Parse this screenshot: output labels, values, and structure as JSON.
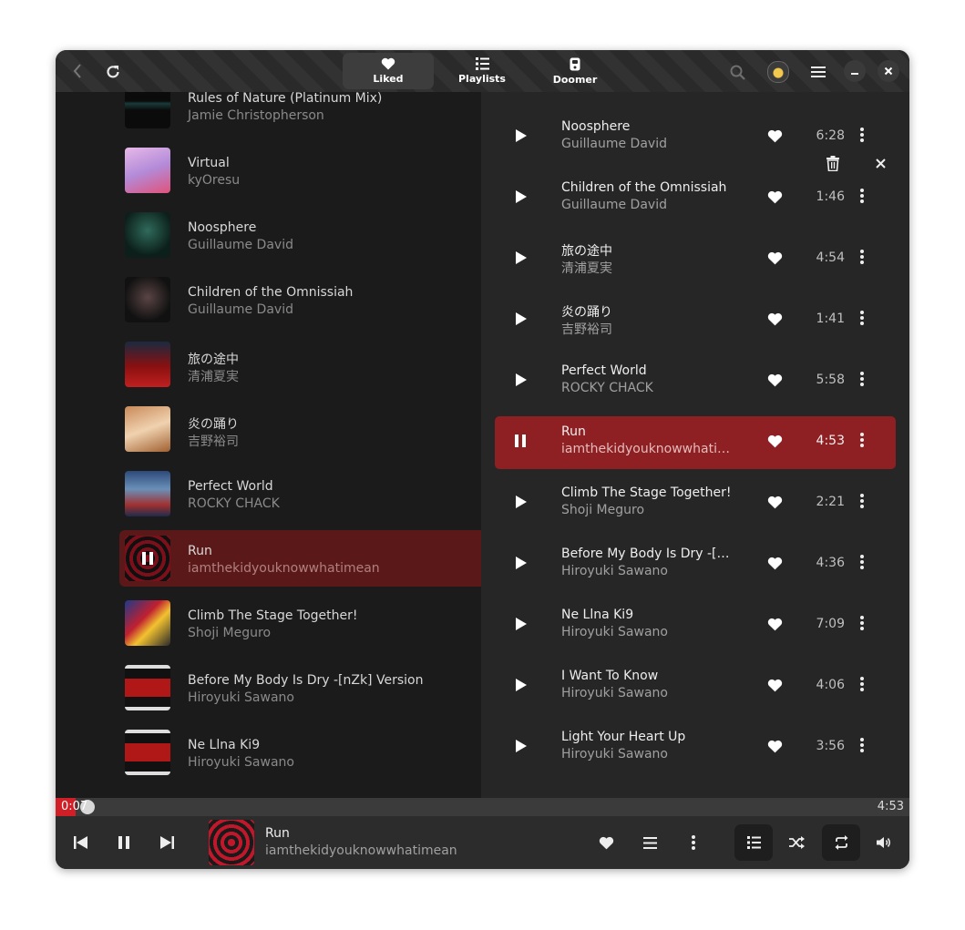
{
  "header": {
    "tabs": [
      {
        "label": "Liked",
        "icon": "heart-icon",
        "active": true
      },
      {
        "label": "Playlists",
        "icon": "list-icon",
        "active": false
      },
      {
        "label": "Doomer",
        "icon": "device-icon",
        "active": false
      }
    ]
  },
  "library": {
    "items": [
      {
        "title": "Rules of Nature (Platinum Mix)",
        "artist": "Jamie Christopherson"
      },
      {
        "title": "Virtual",
        "artist": "kyOresu"
      },
      {
        "title": "Noosphere",
        "artist": "Guillaume David"
      },
      {
        "title": "Children of the Omnissiah",
        "artist": "Guillaume David"
      },
      {
        "title": "旅の途中",
        "artist": "清浦夏実"
      },
      {
        "title": "炎の踊り",
        "artist": "吉野裕司"
      },
      {
        "title": "Perfect World",
        "artist": "ROCKY CHACK"
      },
      {
        "title": "Run",
        "artist": "iamthekidyouknowwhatimean",
        "playing": true
      },
      {
        "title": "Climb The Stage Together!",
        "artist": "Shoji Meguro"
      },
      {
        "title": "Before My Body Is Dry -[nZk] Version",
        "artist": "Hiroyuki Sawano"
      },
      {
        "title": "Ne Llna Ki9",
        "artist": "Hiroyuki Sawano"
      }
    ]
  },
  "queue": {
    "items": [
      {
        "title": "Noosphere",
        "artist": "Guillaume David",
        "duration": "6:28"
      },
      {
        "title": "Children of the Omnissiah",
        "artist": "Guillaume David",
        "duration": "1:46"
      },
      {
        "title": "旅の途中",
        "artist": "清浦夏実",
        "duration": "4:54"
      },
      {
        "title": "炎の踊り",
        "artist": "吉野裕司",
        "duration": "1:41"
      },
      {
        "title": "Perfect World",
        "artist": "ROCKY CHACK",
        "duration": "5:58"
      },
      {
        "title": "Run",
        "artist": "iamthekidyouknowwhatim…",
        "duration": "4:53",
        "playing": true
      },
      {
        "title": "Climb The Stage Together!",
        "artist": "Shoji Meguro",
        "duration": "2:21"
      },
      {
        "title": "Before My Body Is Dry -[n…",
        "artist": "Hiroyuki Sawano",
        "duration": "4:36"
      },
      {
        "title": "Ne Llna Ki9",
        "artist": "Hiroyuki Sawano",
        "duration": "7:09"
      },
      {
        "title": "I Want To Know",
        "artist": "Hiroyuki Sawano",
        "duration": "4:06"
      },
      {
        "title": "Light Your Heart Up",
        "artist": "Hiroyuki Sawano",
        "duration": "3:56"
      }
    ]
  },
  "progress": {
    "elapsed": "0:07",
    "total": "4:53",
    "fraction": 0.024
  },
  "now_playing": {
    "title": "Run",
    "artist": "iamthekidyouknowwhatimean"
  },
  "colors": {
    "accent": "#d01f26",
    "active_row": "#8e1f22",
    "active_row_left": "#5a1818"
  }
}
